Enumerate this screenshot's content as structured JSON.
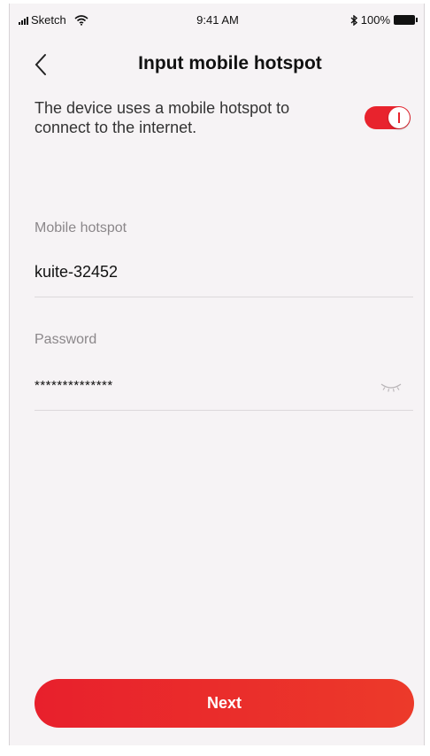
{
  "status_bar": {
    "carrier": "Sketch",
    "time": "9:41 AM",
    "battery": "100%",
    "icons": [
      "signal-icon",
      "wifi-icon",
      "bluetooth-icon",
      "battery-icon"
    ]
  },
  "header": {
    "title": "Input mobile hotspot",
    "back_icon": "chevron-left-icon"
  },
  "hotspot_toggle": {
    "description": "The device uses a mobile hotspot to connect to the internet.",
    "enabled": true
  },
  "form": {
    "hotspot_label": "Mobile hotspot",
    "hotspot_value": "kuite-32452",
    "password_label": "Password",
    "password_value": "**************",
    "password_icon": "eye-closed-icon"
  },
  "next_label": "Next",
  "colors": {
    "accent": "#e8232d",
    "background": "#f6f3f5",
    "label": "#8b878a"
  }
}
